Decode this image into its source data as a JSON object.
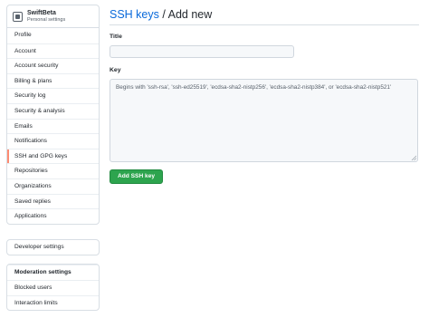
{
  "account": {
    "name": "SwiftBeta",
    "subtitle": "Personal settings",
    "avatar_icon": "swiftbeta-logo-icon"
  },
  "sidebar": {
    "items": [
      {
        "label": "Profile"
      },
      {
        "label": "Account"
      },
      {
        "label": "Account security"
      },
      {
        "label": "Billing & plans"
      },
      {
        "label": "Security log"
      },
      {
        "label": "Security & analysis"
      },
      {
        "label": "Emails"
      },
      {
        "label": "Notifications"
      },
      {
        "label": "SSH and GPG keys",
        "selected": true
      },
      {
        "label": "Repositories"
      },
      {
        "label": "Organizations"
      },
      {
        "label": "Saved replies"
      },
      {
        "label": "Applications"
      }
    ],
    "developer": {
      "label": "Developer settings"
    },
    "moderation": {
      "heading": "Moderation settings",
      "items": [
        {
          "label": "Blocked users"
        },
        {
          "label": "Interaction limits"
        }
      ]
    }
  },
  "main": {
    "breadcrumb": "SSH keys",
    "separator": " / ",
    "title": "Add new",
    "title_label": "Title",
    "title_value": "",
    "key_label": "Key",
    "key_placeholder": "Begins with 'ssh-rsa', 'ssh-ed25519', 'ecdsa-sha2-nistp256', 'ecdsa-sha2-nistp384', or 'ecdsa-sha2-nistp521'",
    "submit_label": "Add SSH key"
  },
  "colors": {
    "accent": "#0969da",
    "primary_button": "#2da44e",
    "selected_marker": "#fd8c73"
  }
}
